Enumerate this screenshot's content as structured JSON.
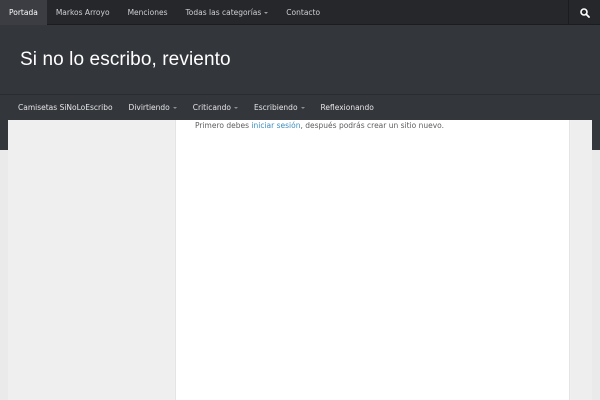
{
  "topbar": {
    "items": [
      {
        "label": "Portada"
      },
      {
        "label": "Markos Arroyo"
      },
      {
        "label": "Menciones"
      },
      {
        "label": "Todas las categorías"
      },
      {
        "label": "Contacto"
      }
    ]
  },
  "header": {
    "site_title": "Si no lo escribo, reviento"
  },
  "mainnav": {
    "items": [
      {
        "label": "Camisetas SiNoLoEscribo"
      },
      {
        "label": "Divirtiendo"
      },
      {
        "label": "Criticando"
      },
      {
        "label": "Escribiendo"
      },
      {
        "label": "Reflexionando"
      }
    ]
  },
  "content": {
    "notice_prefix": "Primero debes ",
    "login_link": "iniciar sesión",
    "notice_suffix": ", después podrás crear un sitio nuevo."
  },
  "colors": {
    "topbar_bg": "#26272b",
    "header_bg": "#33363b",
    "active_item_bg": "#3c3d42",
    "link": "#3b8dbd"
  }
}
